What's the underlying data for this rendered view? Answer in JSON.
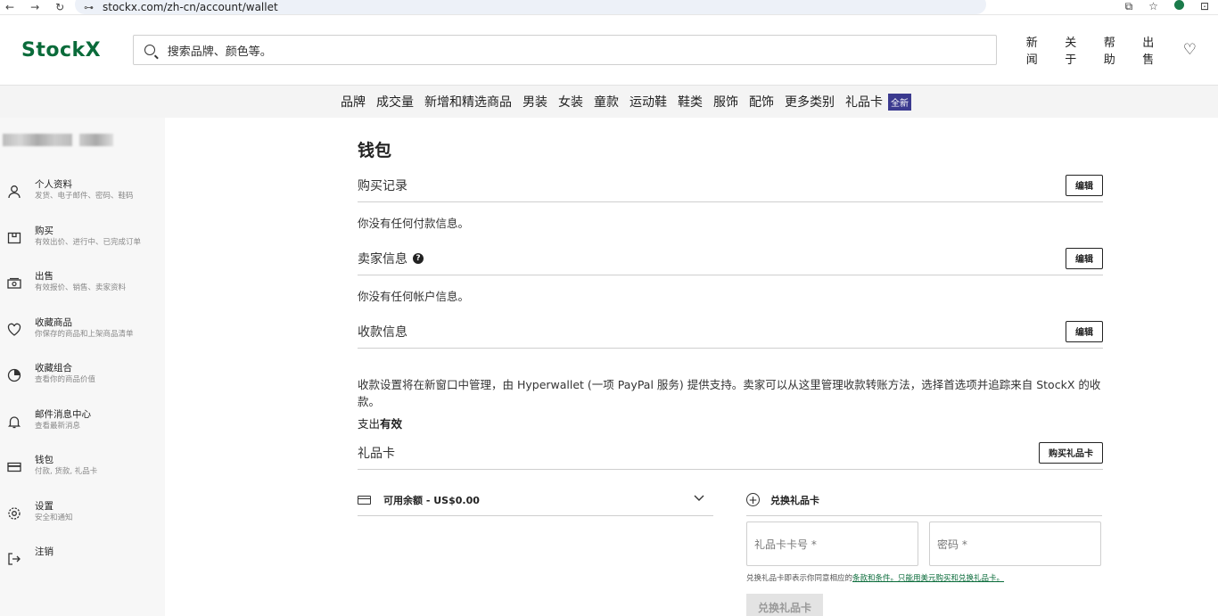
{
  "browser": {
    "url": "stockx.com/zh-cn/account/wallet",
    "back": "←",
    "forward": "→",
    "reload": "↻",
    "tune_icon": "⊶",
    "right_icons": [
      "⧉",
      "☆",
      "⊡"
    ]
  },
  "header": {
    "logo": "StockX",
    "search_placeholder": "搜索品牌、颜色等。",
    "nav": [
      "新闻",
      "关于",
      "帮助",
      "出售"
    ],
    "heart": "♡"
  },
  "categories": [
    "品牌",
    "成交量",
    "新增和精选商品",
    "男装",
    "女装",
    "童款",
    "运动鞋",
    "鞋类",
    "服饰",
    "配饰",
    "更多类别",
    "礼品卡"
  ],
  "category_badge": "全新",
  "sidebar": {
    "items": [
      {
        "title": "个人资料",
        "sub": "发货、电子邮件、密码、鞋码",
        "icon": "user-icon"
      },
      {
        "title": "购买",
        "sub": "有效出价、进行中、已完成订单",
        "icon": "box-icon"
      },
      {
        "title": "出售",
        "sub": "有效报价、销售、卖家资料",
        "icon": "cash-icon"
      },
      {
        "title": "收藏商品",
        "sub": "你保存的商品和上架商品清单",
        "icon": "heart-icon"
      },
      {
        "title": "收藏组合",
        "sub": "查看你的商品价值",
        "icon": "pie-chart-icon"
      },
      {
        "title": "邮件消息中心",
        "sub": "查看最新消息",
        "icon": "bell-icon"
      },
      {
        "title": "钱包",
        "sub": "付款, 货款, 礼品卡",
        "icon": "wallet-card-icon"
      },
      {
        "title": "设置",
        "sub": "安全和通知",
        "icon": "gear-icon"
      },
      {
        "title": "注销",
        "sub": "",
        "icon": "logout-icon"
      }
    ]
  },
  "main": {
    "title": "钱包",
    "purchase": {
      "title": "购买记录",
      "button": "编辑",
      "empty": "你没有任何付款信息。"
    },
    "seller": {
      "title": "卖家信息",
      "help": "?",
      "button": "编辑",
      "empty": "你没有任何帐户信息。"
    },
    "payout": {
      "title": "收款信息",
      "button": "编辑",
      "description": "收款设置将在新窗口中管理，由 Hyperwallet (一项 PayPal 服务) 提供支持。卖家可以从这里管理收款转账方法，选择首选项并追踪来自 StockX 的收款。",
      "status_label": "支出",
      "status_value": "有效"
    },
    "gift": {
      "title": "礼品卡",
      "button": "购买礼品卡",
      "balance": "可用余额 - US$0.00",
      "redeem_title": "兑换礼品卡",
      "card_number_placeholder": "礼品卡卡号 *",
      "pin_placeholder": "密码 *",
      "terms_prefix": "兑换礼品卡即表示你同意相应的",
      "terms_link": "条款和条件。只能用美元购买和兑换礼品卡。",
      "redeem_button": "兑换礼品卡"
    }
  }
}
